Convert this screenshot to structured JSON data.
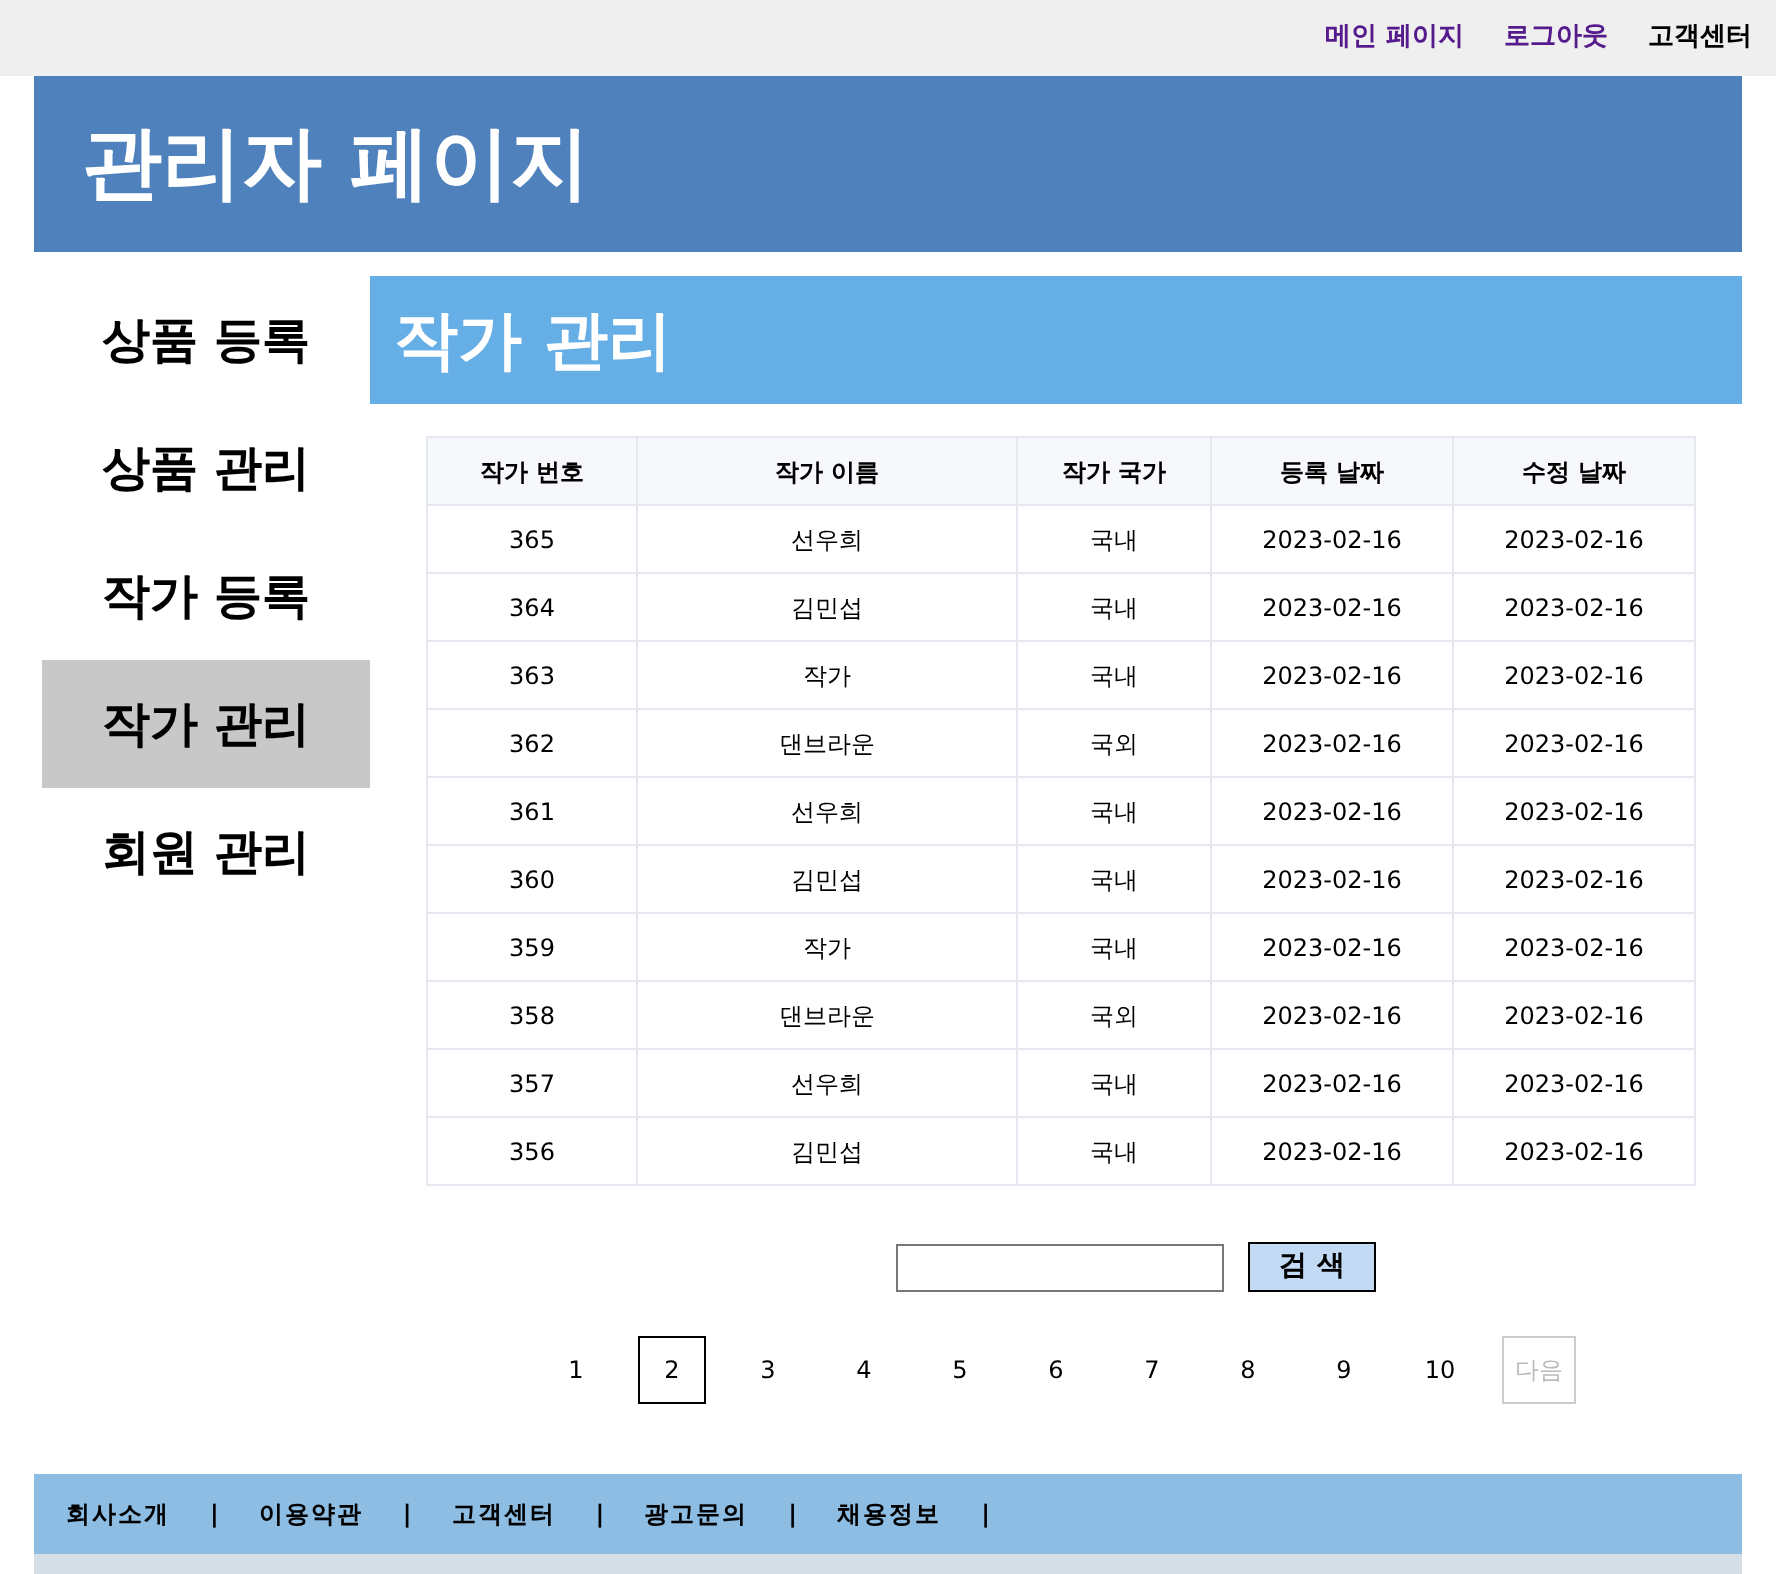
{
  "top_links": [
    {
      "label": "메인 페이지",
      "visited": true
    },
    {
      "label": "로그아웃",
      "visited": true
    },
    {
      "label": "고객센터",
      "visited": false
    }
  ],
  "header": {
    "title": "관리자 페이지"
  },
  "sidebar": {
    "items": [
      {
        "label": "상품 등록",
        "selected": false
      },
      {
        "label": "상품 관리",
        "selected": false
      },
      {
        "label": "작가 등록",
        "selected": false
      },
      {
        "label": "작가 관리",
        "selected": true
      },
      {
        "label": "회원 관리",
        "selected": false
      }
    ]
  },
  "content": {
    "title": "작가 관리"
  },
  "table": {
    "columns": [
      "작가 번호",
      "작가 이름",
      "작가 국가",
      "등록 날짜",
      "수정 날짜"
    ],
    "rows": [
      [
        "365",
        "선우희",
        "국내",
        "2023-02-16",
        "2023-02-16"
      ],
      [
        "364",
        "김민섭",
        "국내",
        "2023-02-16",
        "2023-02-16"
      ],
      [
        "363",
        "작가",
        "국내",
        "2023-02-16",
        "2023-02-16"
      ],
      [
        "362",
        "댄브라운",
        "국외",
        "2023-02-16",
        "2023-02-16"
      ],
      [
        "361",
        "선우희",
        "국내",
        "2023-02-16",
        "2023-02-16"
      ],
      [
        "360",
        "김민섭",
        "국내",
        "2023-02-16",
        "2023-02-16"
      ],
      [
        "359",
        "작가",
        "국내",
        "2023-02-16",
        "2023-02-16"
      ],
      [
        "358",
        "댄브라운",
        "국외",
        "2023-02-16",
        "2023-02-16"
      ],
      [
        "357",
        "선우희",
        "국내",
        "2023-02-16",
        "2023-02-16"
      ],
      [
        "356",
        "김민섭",
        "국내",
        "2023-02-16",
        "2023-02-16"
      ]
    ]
  },
  "search": {
    "button": "검 색"
  },
  "pagination": {
    "pages": [
      {
        "label": "1",
        "selected": false
      },
      {
        "label": "2",
        "selected": true
      },
      {
        "label": "3",
        "selected": false
      },
      {
        "label": "4",
        "selected": false
      },
      {
        "label": "5",
        "selected": false
      },
      {
        "label": "6",
        "selected": false
      },
      {
        "label": "7",
        "selected": false
      },
      {
        "label": "8",
        "selected": false
      },
      {
        "label": "9",
        "selected": false
      },
      {
        "label": "10",
        "selected": false
      }
    ],
    "next": {
      "label": "다음",
      "disabled": true
    }
  },
  "footer": {
    "links": [
      {
        "label": "회사소개",
        "separator": "|"
      },
      {
        "label": "이용약관",
        "separator": "|"
      },
      {
        "label": "고객센터",
        "separator": "|"
      },
      {
        "label": "광고문의",
        "separator": "|"
      },
      {
        "label": "채용정보",
        "separator": "|"
      }
    ]
  }
}
